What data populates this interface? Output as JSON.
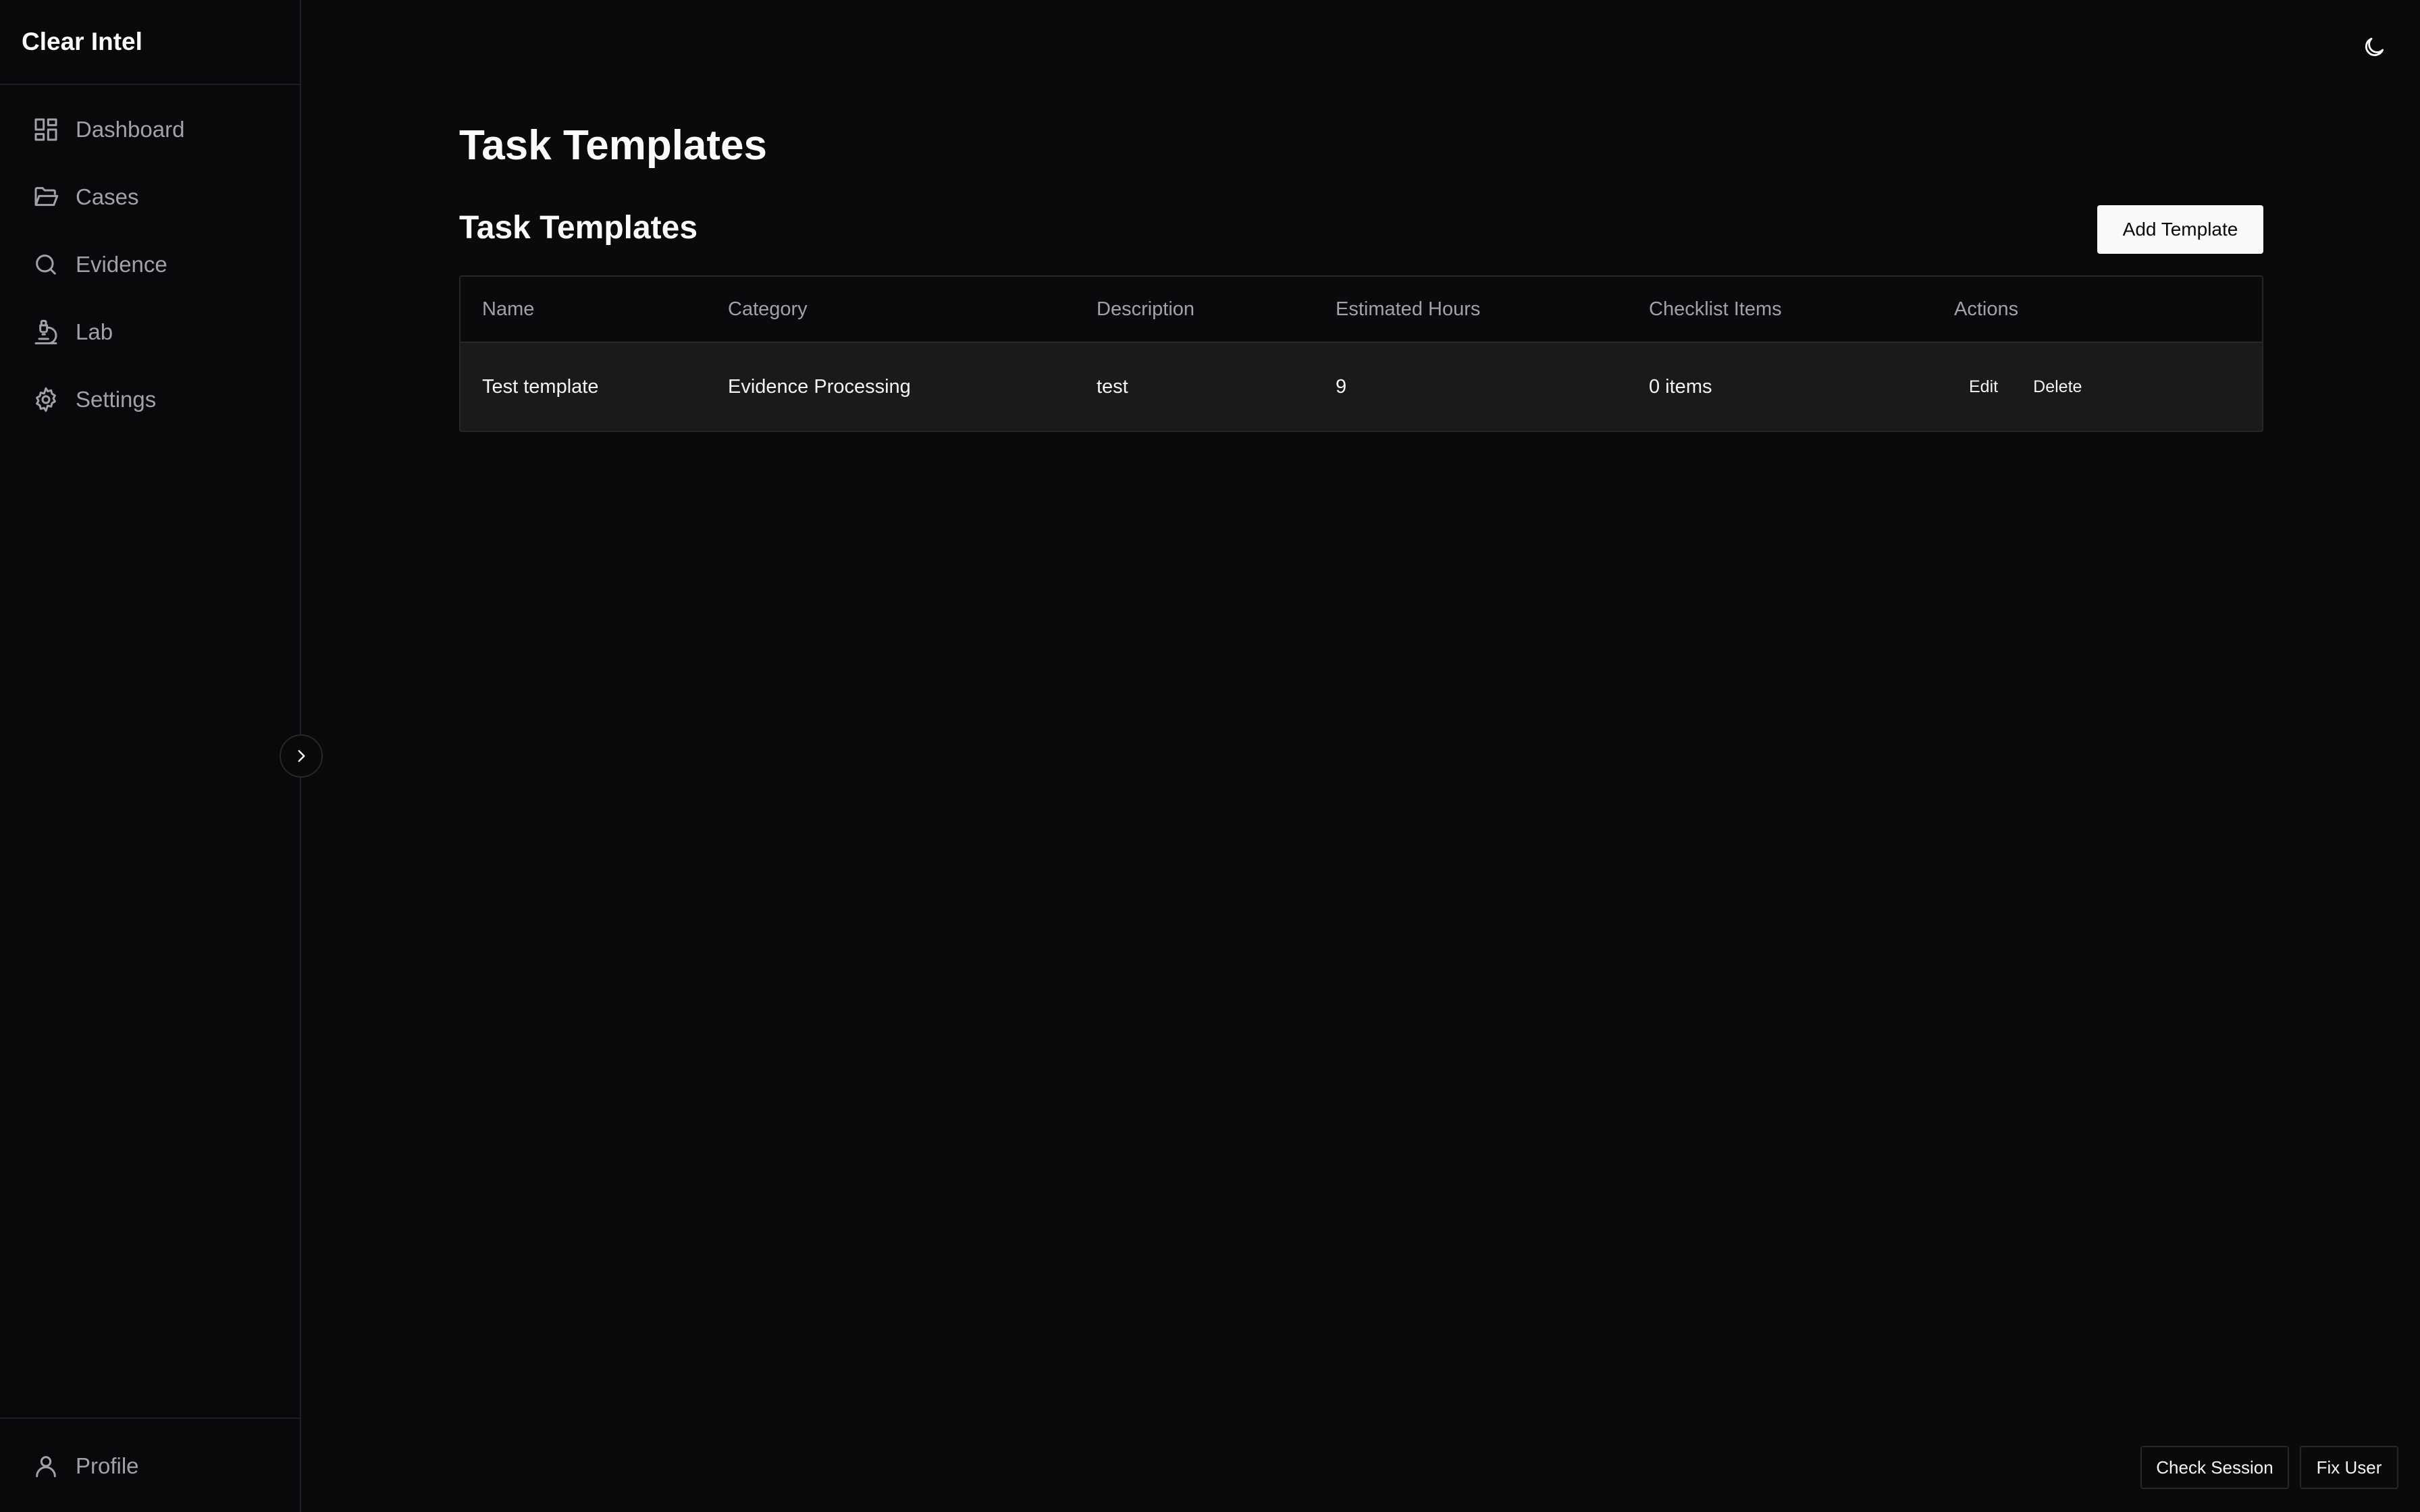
{
  "app": {
    "name": "Clear Intel"
  },
  "sidebar": {
    "items": [
      {
        "label": "Dashboard",
        "icon": "dashboard-icon"
      },
      {
        "label": "Cases",
        "icon": "folder-open-icon"
      },
      {
        "label": "Evidence",
        "icon": "search-icon"
      },
      {
        "label": "Lab",
        "icon": "microscope-icon"
      },
      {
        "label": "Settings",
        "icon": "gear-icon"
      }
    ],
    "footer": {
      "label": "Profile",
      "icon": "user-icon"
    }
  },
  "page": {
    "title": "Task Templates",
    "section_title": "Task Templates",
    "add_button": "Add Template"
  },
  "table": {
    "columns": [
      "Name",
      "Category",
      "Description",
      "Estimated Hours",
      "Checklist Items",
      "Actions"
    ],
    "rows": [
      {
        "name": "Test template",
        "category": "Evidence Processing",
        "description": "test",
        "estimated_hours": "9",
        "checklist_items": "0 items",
        "edit_label": "Edit",
        "delete_label": "Delete"
      }
    ]
  },
  "footer_buttons": {
    "check_session": "Check Session",
    "fix_user": "Fix User"
  }
}
